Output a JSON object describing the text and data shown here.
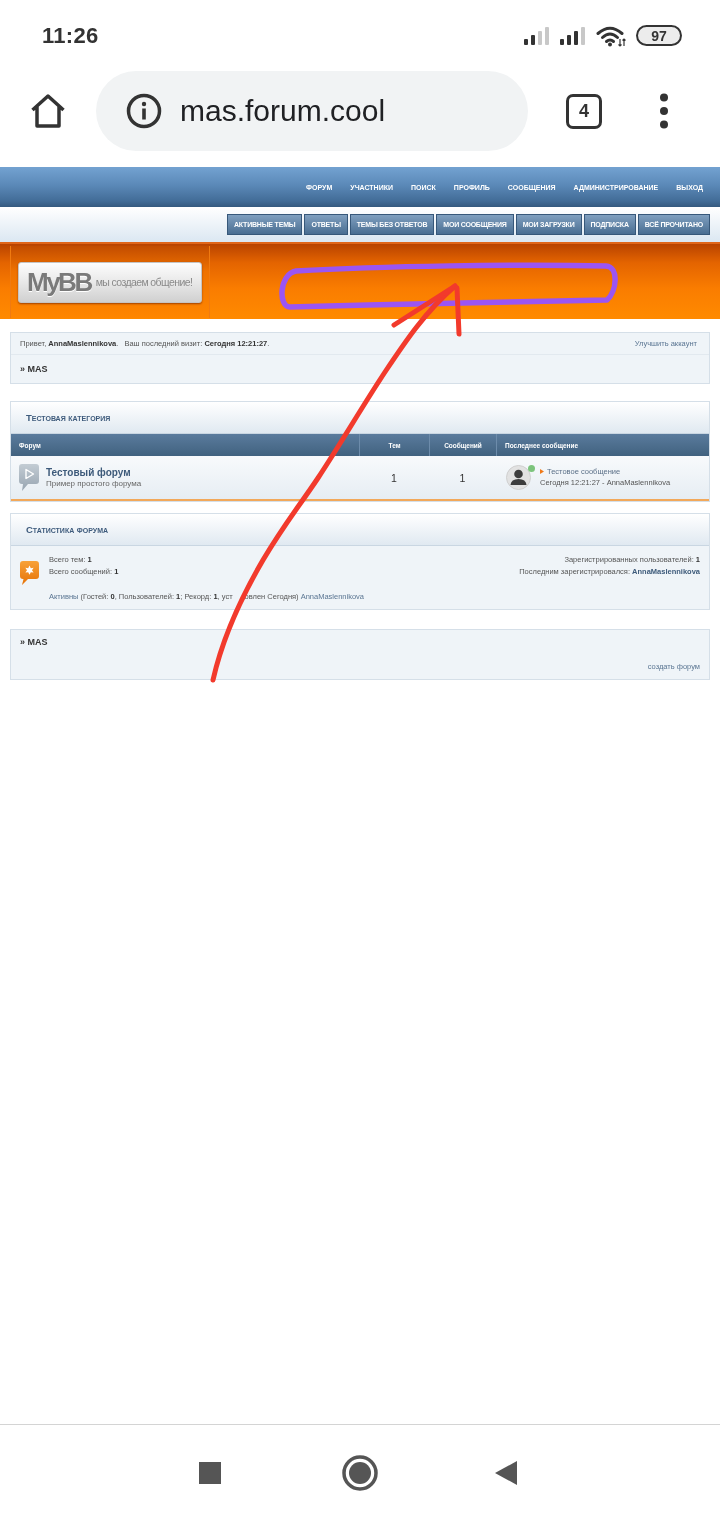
{
  "status_bar": {
    "time": "11:26",
    "battery": "97"
  },
  "browser": {
    "url": "mas.forum.cool",
    "tab_count": "4"
  },
  "forum": {
    "top_nav": [
      "ФОРУМ",
      "УЧАСТНИКИ",
      "ПОИСК",
      "ПРОФИЛЬ",
      "СООБЩЕНИЯ",
      "АДМИНИСТРИРОВАНИЕ",
      "ВЫХОД"
    ],
    "sub_nav": [
      "АКТИВНЫЕ ТЕМЫ",
      "ОТВЕТЫ",
      "ТЕМЫ БЕЗ ОТВЕТОВ",
      "МОИ СООБЩЕНИЯ",
      "МОИ ЗАГРУЗКИ",
      "ПОДПИСКА",
      "ВСЁ ПРОЧИТАНО"
    ],
    "logo": {
      "name": "MyBB",
      "tagline": "мы создаем общение!"
    },
    "welcome": {
      "greeting": "Привет, **AnnaMaslennikova**.",
      "last_visit": "Ваш последний визит: **Сегодня 12:21:27**.",
      "upgrade_link": "Улучшить аккаунт",
      "breadcrumb": "» MAS"
    },
    "category": {
      "title": "Тестовая категория",
      "columns": [
        "Форум",
        "Тем",
        "Сообщений",
        "Последнее сообщение"
      ],
      "rows": [
        {
          "name": "Тестовый форум",
          "description": "Пример простого форума",
          "topics": "1",
          "posts": "1",
          "last_post": {
            "title": "Тестовое сообщение",
            "meta": "Сегодня 12:21:27 - AnnaMaslennikova",
            "online": true
          }
        }
      ]
    },
    "stats": {
      "title": "Статистика форума",
      "left": [
        "Всего тем: **1**",
        "Всего сообщений: **1**"
      ],
      "right": [
        {
          "kind": "count",
          "label": "Зарегистрированных пользователей:",
          "value": "1"
        },
        {
          "kind": "link",
          "label": "Последним зарегистрировался:",
          "value": "AnnaMaslennikova"
        }
      ],
      "online": {
        "link": "Активны",
        "details": "(Гостей: **0**, Пользователей: **1**; Рекорд: **1**, уст",
        "details_after_cover": "овлен Сегодня)",
        "user": "AnnaMaslennikova"
      }
    },
    "footer": {
      "breadcrumb": "» MAS",
      "create_link": "создать форум"
    }
  },
  "annotations": [
    {
      "kind": "ellipse",
      "color": "#9b55f2"
    },
    {
      "kind": "arrow",
      "color": "#f23a2c"
    }
  ]
}
